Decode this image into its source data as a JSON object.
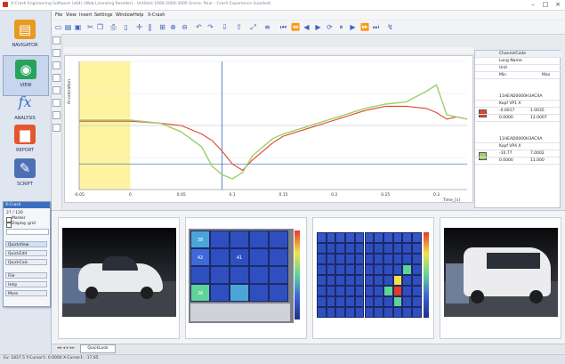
{
  "window": {
    "title": "X-Crash Engineering Software (x64) (Web-Licensing Reseller) - Untitled   1000-2000-3000 Scene: Rear - Crash Experience (Loaded)"
  },
  "menu": [
    "File",
    "View",
    "Insert",
    "Settings",
    "Window",
    "Help",
    "X-Crash"
  ],
  "nav": [
    {
      "label": "NAVIGATOR",
      "icon": "folder-stack-icon",
      "color": "#e79a1f"
    },
    {
      "label": "VIEW",
      "icon": "eye-globe-icon",
      "color": "#27a35a"
    },
    {
      "label": "ANALYSIS",
      "icon": "fx-icon",
      "color": "#ffffff"
    },
    {
      "label": "REPORT",
      "icon": "bar-chart-icon",
      "color": "#e4572e"
    },
    {
      "label": "SCRIPT",
      "icon": "script-icon",
      "color": "#4d6fb5"
    }
  ],
  "quick_panel": {
    "title": "X-Crash",
    "lines": [
      "27 / 120",
      "Marker",
      "Display grid"
    ],
    "buttons": [
      "QuickView",
      "QuickEdit",
      "QuickCalc",
      "File",
      "Help",
      "More"
    ]
  },
  "plot": {
    "yaxis_label": "Acceleration",
    "x_ticks": [
      "-0.05",
      "0",
      "0.05",
      "0.1",
      "0.15",
      "0.2",
      "0.25",
      "0.3"
    ],
    "x_unit": "Time_[s]"
  },
  "chart_data": {
    "type": "line",
    "xlim": [
      -0.05,
      0.33
    ],
    "ylim": [
      -3,
      3
    ],
    "highlight_region": [
      -0.05,
      0
    ],
    "cursor_x": 0.09,
    "series": [
      {
        "color": "#e0452a",
        "x": [
          -0.05,
          0,
          0.03,
          0.05,
          0.07,
          0.08,
          0.09,
          0.1,
          0.11,
          0.12,
          0.13,
          0.14,
          0.15,
          0.17,
          0.19,
          0.21,
          0.23,
          0.25,
          0.27,
          0.29,
          0.3,
          0.31,
          0.32,
          0.33
        ],
        "y": [
          0.2,
          0.2,
          0.1,
          0.0,
          -0.4,
          -0.7,
          -1.2,
          -1.8,
          -2.1,
          -1.6,
          -1.2,
          -0.8,
          -0.5,
          -0.2,
          0.1,
          0.4,
          0.7,
          0.9,
          0.9,
          0.8,
          0.6,
          0.3,
          0.4,
          0.3
        ]
      },
      {
        "color": "#9ccf6a",
        "x": [
          -0.05,
          0,
          0.03,
          0.05,
          0.07,
          0.08,
          0.09,
          0.1,
          0.11,
          0.12,
          0.13,
          0.14,
          0.15,
          0.17,
          0.19,
          0.21,
          0.23,
          0.25,
          0.27,
          0.29,
          0.3,
          0.31,
          0.32,
          0.33
        ],
        "y": [
          0.25,
          0.25,
          0.1,
          -0.3,
          -1.0,
          -1.9,
          -2.3,
          -2.5,
          -2.2,
          -1.4,
          -1.0,
          -0.6,
          -0.4,
          -0.1,
          0.2,
          0.5,
          0.8,
          1.0,
          1.1,
          1.6,
          1.9,
          0.5,
          0.4,
          0.3
        ]
      }
    ]
  },
  "channel_panel": {
    "headers": [
      "ChannelCode",
      "Long Name",
      "Unit",
      "Min",
      "Max"
    ],
    "rows": [
      {
        "code": "11HEAD0000H3ACXA",
        "name": "Kopf VP1 X",
        "v1": "-0.0017",
        "v2": "1.0035",
        "v3": "0.0000",
        "v4": "12.0007",
        "color": "#e0452a"
      },
      {
        "code": "11HEAD0000H3ACXA",
        "name": "Kopf VP4 X",
        "v1": "-10.77",
        "v2": "7.0002",
        "v3": "0.0000",
        "v4": "11.000",
        "color": "#9ccf6a"
      }
    ]
  },
  "matrix_left": {
    "cells": [
      {
        "label": "38",
        "value": 0.45
      },
      {
        "label": "",
        "value": 0.1
      },
      {
        "label": "",
        "value": 0.1
      },
      {
        "label": "",
        "value": 0.1
      },
      {
        "label": "",
        "value": 0.1
      },
      {
        "label": "42",
        "value": 0.3
      },
      {
        "label": "",
        "value": 0.1
      },
      {
        "label": "41",
        "value": 0.2
      },
      {
        "label": "",
        "value": 0.1
      },
      {
        "label": "",
        "value": 0.1
      },
      {
        "label": "",
        "value": 0.1
      },
      {
        "label": "",
        "value": 0.1
      },
      {
        "label": "",
        "value": 0.15
      },
      {
        "label": "",
        "value": 0.1
      },
      {
        "label": "",
        "value": 0.1
      },
      {
        "label": "38",
        "value": 0.6
      },
      {
        "label": "",
        "value": 0.1
      },
      {
        "label": "",
        "value": 0.5
      },
      {
        "label": "",
        "value": 0.1
      },
      {
        "label": "",
        "value": 0.1
      }
    ]
  },
  "matrix_right": {
    "hot": [
      {
        "r": 5,
        "c": 8,
        "color": "#e33a2a"
      },
      {
        "r": 4,
        "c": 8,
        "color": "#f1e24a"
      },
      {
        "r": 5,
        "c": 7,
        "color": "#5ed39a"
      },
      {
        "r": 6,
        "c": 8,
        "color": "#5ed39a"
      },
      {
        "r": 3,
        "c": 9,
        "color": "#5ed39a"
      }
    ]
  },
  "tabs": [
    "QuickLook"
  ],
  "status": {
    "text": "Ev: 1837.5 Y-Cursor1: 0.0000   X-Cursor1: -17.65"
  },
  "colors": {
    "accent": "#3c6ec0",
    "highlight": "#fdf3a0",
    "cursor": "#3366bb"
  }
}
